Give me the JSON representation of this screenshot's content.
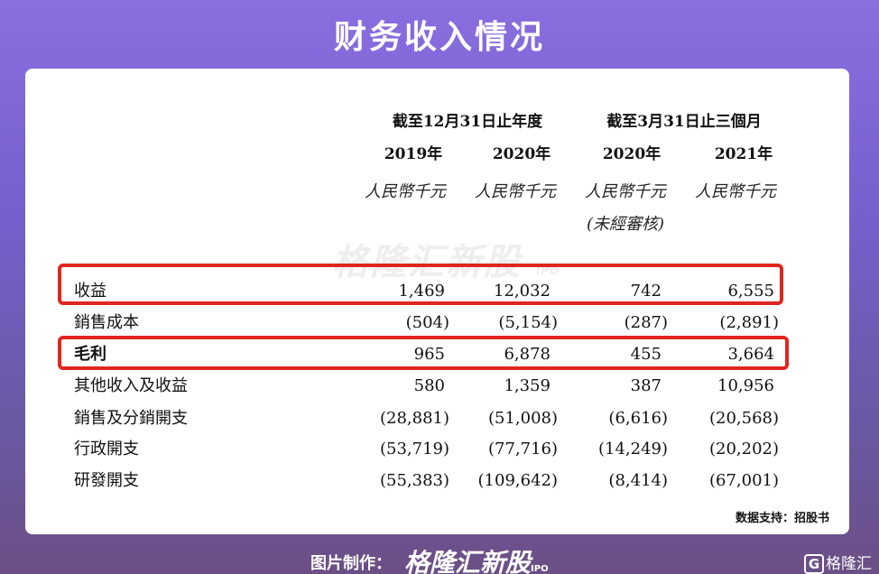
{
  "title": "财务收入情况",
  "table": {
    "group_headers": [
      "截至12月31日止年度",
      "截至3月31日止三個月"
    ],
    "years": [
      "2019年",
      "2020年",
      "2020年",
      "2021年"
    ],
    "units": [
      "人民幣千元",
      "人民幣千元",
      "人民幣千元",
      "人民幣千元"
    ],
    "unaudited": "(未經審核)",
    "rows": [
      {
        "label": "收益",
        "values": [
          "1,469",
          "12,032",
          "742",
          "6,555"
        ],
        "highlighted": true
      },
      {
        "label": "銷售成本",
        "values": [
          "(504)",
          "(5,154)",
          "(287)",
          "(2,891)"
        ]
      },
      {
        "label": "毛利",
        "values": [
          "965",
          "6,878",
          "455",
          "3,664"
        ],
        "highlighted": true
      },
      {
        "label": "其他收入及收益",
        "values": [
          "580",
          "1,359",
          "387",
          "10,956"
        ]
      },
      {
        "label": "銷售及分銷開支",
        "values": [
          "(28,881)",
          "(51,008)",
          "(6,616)",
          "(20,568)"
        ]
      },
      {
        "label": "行政開支",
        "values": [
          "(53,719)",
          "(77,716)",
          "(14,249)",
          "(20,202)"
        ]
      },
      {
        "label": "研發開支",
        "values": [
          "(55,383)",
          "(109,642)",
          "(8,414)",
          "(67,001)"
        ]
      }
    ]
  },
  "watermark": {
    "text": "格隆汇新股",
    "sub": "IPO"
  },
  "source": "数据支持：招股书",
  "footer": {
    "credit": "图片制作：",
    "logo": "格隆汇新股",
    "logo_sub": "IPO",
    "corner_mark": "G",
    "corner": "格隆汇"
  },
  "colors": {
    "highlight": "#e0261f",
    "background": "#7860cf"
  }
}
